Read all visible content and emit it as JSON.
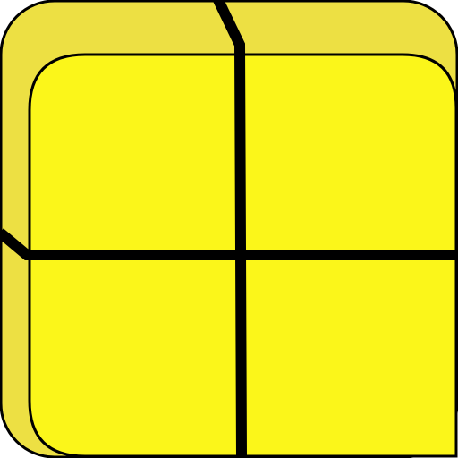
{
  "icon": {
    "name": "window-grid-icon",
    "colors": {
      "back_face": "#EDE043",
      "front_face": "#FBF61A",
      "stroke": "#000000"
    }
  }
}
